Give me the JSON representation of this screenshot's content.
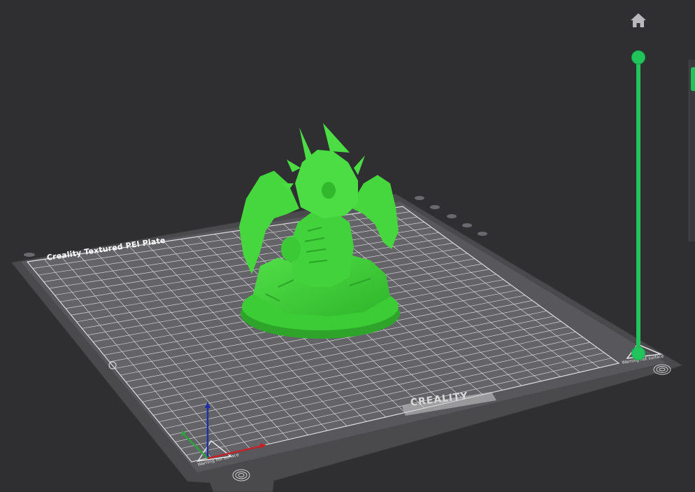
{
  "bed": {
    "title": "Creality Textured PEI Plate",
    "brand": "CREALITY",
    "warning_left": "Warning hot surface",
    "warning_right": "Warning hot surface"
  },
  "icons": {
    "home": "home-icon",
    "fingerprint": "fingerprint-icon"
  },
  "layer_slider": {
    "top_level": 1.0,
    "bottom_level": 0.0
  },
  "colors": {
    "background": "#2f2f31",
    "accent": "#21c45a",
    "model": "#3fd33a",
    "bed": "#515155",
    "grid": "#cfcfcf",
    "axis_x": "#c0242a",
    "axis_y": "#2aa43a",
    "axis_z": "#1f2fa8"
  }
}
